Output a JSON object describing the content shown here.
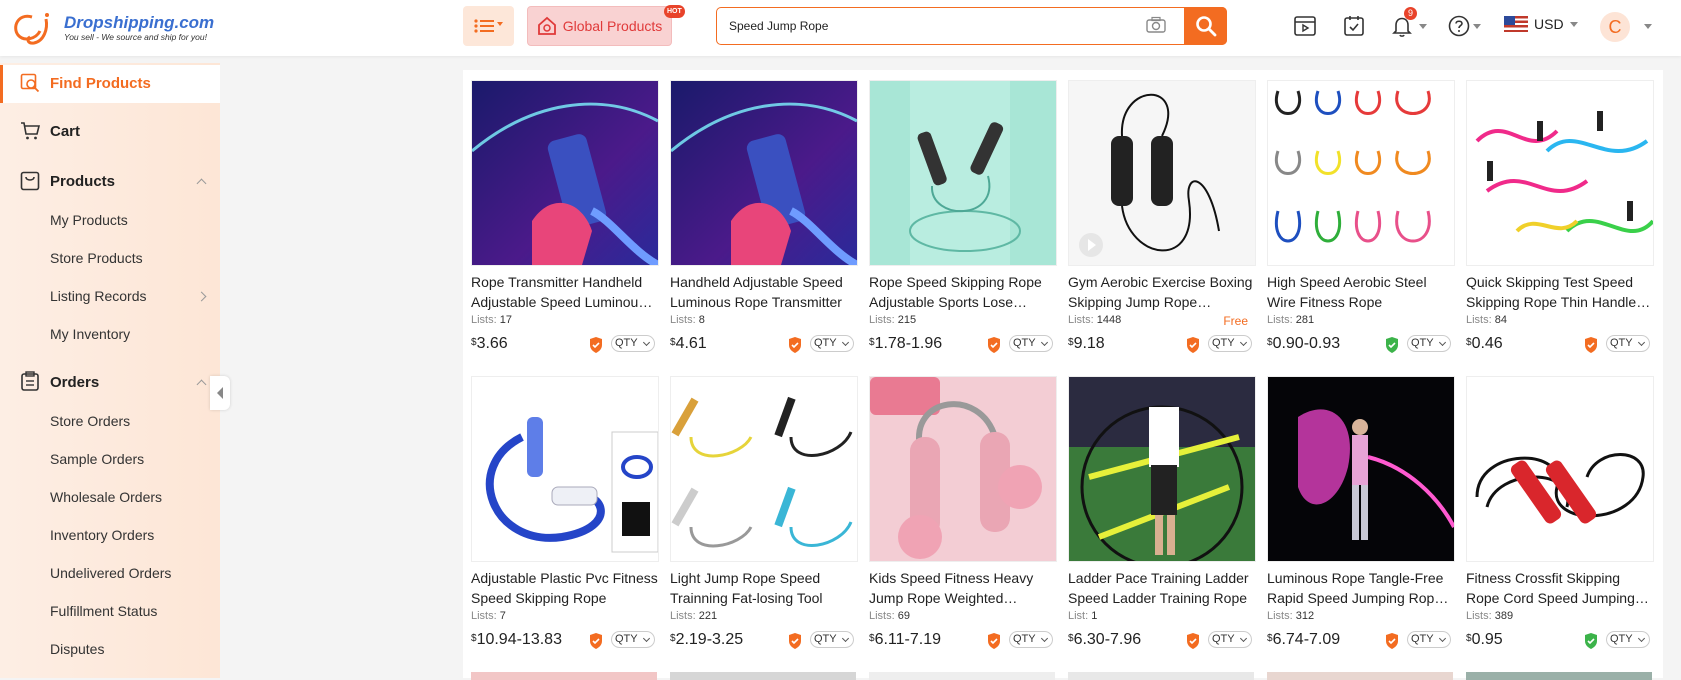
{
  "header": {
    "logo_name": "Dropshipping.com",
    "logo_tagline": "You sell - We source and ship for you!",
    "global_products_label": "Global Products",
    "hot_badge": "HOT",
    "search_value": "Speed Jump Rope",
    "notification_count": "9",
    "currency": "USD",
    "avatar_letter": "C"
  },
  "sidebar": {
    "find_products": "Find Products",
    "cart": "Cart",
    "products": "Products",
    "my_products": "My Products",
    "store_products": "Store Products",
    "listing_records": "Listing Records",
    "my_inventory": "My Inventory",
    "orders": "Orders",
    "store_orders": "Store Orders",
    "sample_orders": "Sample Orders",
    "wholesale_orders": "Wholesale Orders",
    "inventory_orders": "Inventory Orders",
    "undelivered_orders": "Undelivered Orders",
    "fulfillment_status": "Fulfillment Status",
    "disputes": "Disputes"
  },
  "products": [
    {
      "title": "Rope Transmitter Handheld Adjustable Speed Luminous Rope",
      "lists_label": "Lists:",
      "lists": "17",
      "price_symbol": "$",
      "price": "3.66",
      "qty": "QTY",
      "shield": "orange",
      "free": ""
    },
    {
      "title": "Handheld Adjustable Speed Luminous Rope Transmitter",
      "lists_label": "Lists:",
      "lists": "8",
      "price_symbol": "$",
      "price": "4.61",
      "qty": "QTY",
      "shield": "orange",
      "free": ""
    },
    {
      "title": "Rope Speed Skipping Rope Adjustable Sports Lose Weight",
      "lists_label": "Lists:",
      "lists": "215",
      "price_symbol": "$",
      "price": "1.78-1.96",
      "qty": "QTY",
      "shield": "orange",
      "free": ""
    },
    {
      "title": "Gym Aerobic Exercise Boxing Skipping Jump Rope Adjustable",
      "lists_label": "Lists:",
      "lists": "1448",
      "price_symbol": "$",
      "price": "9.18",
      "qty": "QTY",
      "shield": "orange",
      "free": "Free"
    },
    {
      "title": "High Speed Aerobic Steel Wire Fitness Rope",
      "lists_label": "Lists:",
      "lists": "281",
      "price_symbol": "$",
      "price": "0.90-0.93",
      "qty": "QTY",
      "shield": "green",
      "free": ""
    },
    {
      "title": "Quick Skipping Test Speed Skipping Rope Thin Handle Rope",
      "lists_label": "Lists:",
      "lists": "84",
      "price_symbol": "$",
      "price": "0.46",
      "qty": "QTY",
      "shield": "orange",
      "free": ""
    },
    {
      "title": "Adjustable Plastic Pvc Fitness Speed Skipping Rope",
      "lists_label": "Lists:",
      "lists": "7",
      "price_symbol": "$",
      "price": "10.94-13.83",
      "qty": "QTY",
      "shield": "orange",
      "free": ""
    },
    {
      "title": "Light Jump Rope Speed Trainning Fat-losing Tool",
      "lists_label": "Lists:",
      "lists": "221",
      "price_symbol": "$",
      "price": "2.19-3.25",
      "qty": "QTY",
      "shield": "orange",
      "free": ""
    },
    {
      "title": "Kids Speed Fitness Heavy Jump Rope Weighted Cordless",
      "lists_label": "Lists:",
      "lists": "69",
      "price_symbol": "$",
      "price": "6.11-7.19",
      "qty": "QTY",
      "shield": "orange",
      "free": ""
    },
    {
      "title": "Ladder Pace Training Ladder Speed Ladder Training Rope",
      "lists_label": "List:",
      "lists": "1",
      "price_symbol": "$",
      "price": "6.30-7.96",
      "qty": "QTY",
      "shield": "orange",
      "free": ""
    },
    {
      "title": "Luminous Rope Tangle-Free Rapid Speed Jumping Rope Cable",
      "lists_label": "Lists:",
      "lists": "312",
      "price_symbol": "$",
      "price": "6.74-7.09",
      "qty": "QTY",
      "shield": "orange",
      "free": ""
    },
    {
      "title": "Fitness Crossfit Skipping Rope Cord Speed Jumping Rope",
      "lists_label": "Lists:",
      "lists": "389",
      "price_symbol": "$",
      "price": "0.95",
      "qty": "QTY",
      "shield": "green",
      "free": ""
    }
  ],
  "colors": {
    "accent": "#f36c21",
    "shield_orange": "#f36c21",
    "shield_green": "#3cb34a"
  }
}
